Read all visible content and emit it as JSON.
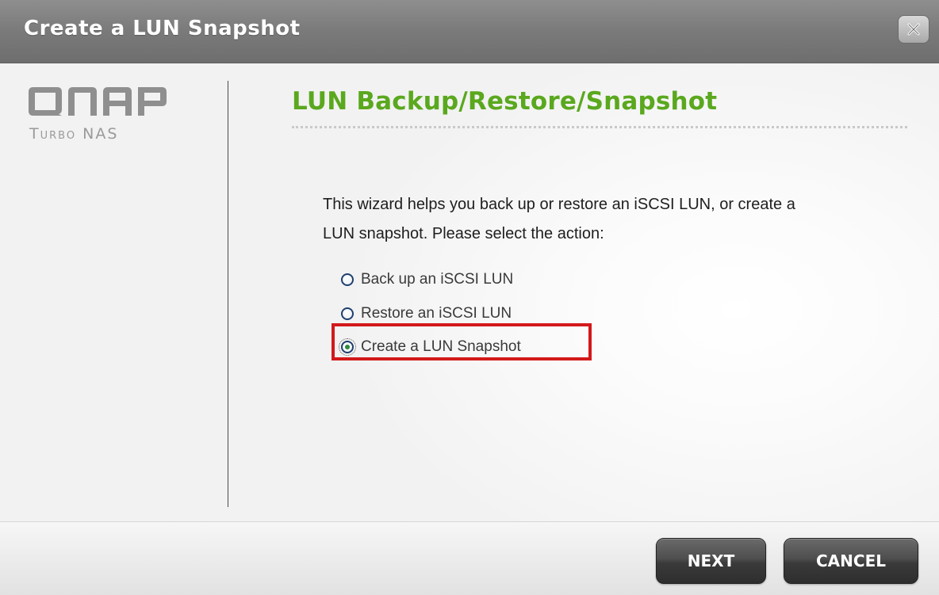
{
  "window": {
    "title": "Create a LUN Snapshot",
    "close_icon": "close-x-icon"
  },
  "logo": {
    "brand": "QNAP",
    "subtitle": "Turbo NAS"
  },
  "wizard": {
    "heading": "LUN Backup/Restore/Snapshot",
    "intro_line1": "This wizard helps you back up or restore an iSCSI LUN, or create a",
    "intro_line2": "LUN snapshot. Please select the action:",
    "options": [
      {
        "label": "Back up an iSCSI LUN",
        "selected": false
      },
      {
        "label": "Restore an iSCSI LUN",
        "selected": false
      },
      {
        "label": "Create a LUN Snapshot",
        "selected": true
      }
    ]
  },
  "footer": {
    "next_label": "NEXT",
    "cancel_label": "CANCEL"
  },
  "colors": {
    "heading": "#5aa81e",
    "highlight": "#d3191b",
    "titlebar": "#7a7a7a"
  }
}
